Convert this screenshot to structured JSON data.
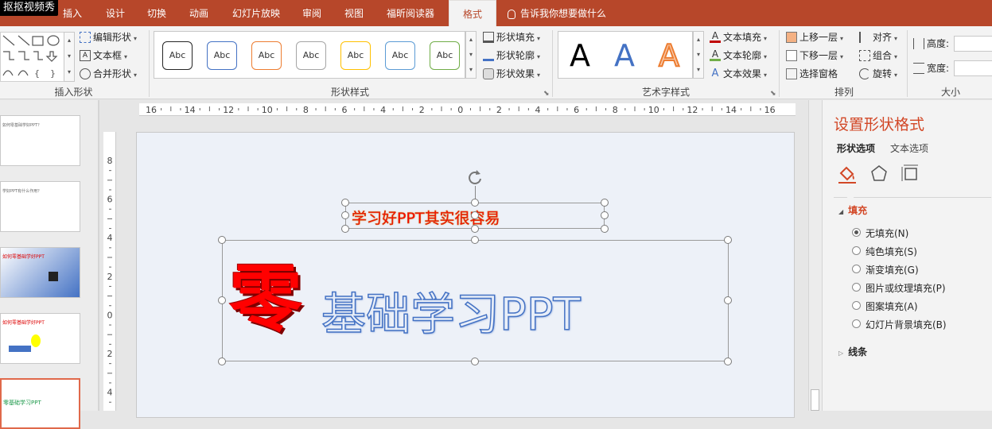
{
  "watermark": "抠抠视频秀",
  "tabs": [
    {
      "label": "插入",
      "active": false
    },
    {
      "label": "设计",
      "active": false
    },
    {
      "label": "切换",
      "active": false
    },
    {
      "label": "动画",
      "active": false
    },
    {
      "label": "幻灯片放映",
      "active": false
    },
    {
      "label": "审阅",
      "active": false
    },
    {
      "label": "视图",
      "active": false
    },
    {
      "label": "福昕阅读器",
      "active": false
    },
    {
      "label": "格式",
      "active": true
    }
  ],
  "tell_me": "告诉我你想要做什么",
  "ribbon": {
    "insert_shapes": {
      "edit_shape": "编辑形状",
      "text_box": "文本框",
      "merge_shapes": "合并形状",
      "label": "插入形状"
    },
    "shape_styles": {
      "preset_text": "Abc",
      "preset_colors": [
        "#262626",
        "#4472c4",
        "#ed7d31",
        "#a5a5a5",
        "#ffc000",
        "#5b9bd5",
        "#70ad47"
      ],
      "fill": "形状填充",
      "outline": "形状轮廓",
      "effects": "形状效果",
      "label": "形状样式"
    },
    "wordart": {
      "letter": "A",
      "text_fill": "文本填充",
      "text_outline": "文本轮廓",
      "text_effects": "文本效果",
      "label": "艺术字样式"
    },
    "arrange": {
      "bring_forward": "上移一层",
      "send_backward": "下移一层",
      "selection_pane": "选择窗格",
      "align": "对齐",
      "group": "组合",
      "rotate": "旋转",
      "label": "排列"
    },
    "size": {
      "height": "高度:",
      "width": "宽度:",
      "label": "大小"
    }
  },
  "thumbnails": [
    {
      "text": "如何零基础学好PPT？",
      "selected": false
    },
    {
      "text": "学好PPT有什么作用？",
      "selected": false
    },
    {
      "text": "如何零基础学好PPT",
      "selected": false
    },
    {
      "text": "如何零基础学好PPT",
      "selected": false
    },
    {
      "text": "零基础学习PPT",
      "selected": true
    }
  ],
  "ruler": {
    "h_ticks": [
      "16",
      "14",
      "12",
      "10",
      "8",
      "6",
      "4",
      "2",
      "0",
      "2",
      "4",
      "6",
      "8",
      "10",
      "12",
      "14",
      "16"
    ],
    "v_ticks": [
      "8",
      "6",
      "4",
      "2",
      "0",
      "2",
      "4"
    ]
  },
  "slide": {
    "subtitle": "学习好PPT其实很容易",
    "big_char": "零",
    "title_rest": "基础学习PPT"
  },
  "panel": {
    "title": "设置形状格式",
    "tab_shape": "形状选项",
    "tab_text": "文本选项",
    "fill_section": "填充",
    "fill_options": [
      {
        "label": "无填充(N)",
        "checked": true
      },
      {
        "label": "纯色填充(S)",
        "checked": false
      },
      {
        "label": "渐变填充(G)",
        "checked": false
      },
      {
        "label": "图片或纹理填充(P)",
        "checked": false
      },
      {
        "label": "图案填充(A)",
        "checked": false
      },
      {
        "label": "幻灯片背景填充(B)",
        "checked": false
      }
    ],
    "line_section": "线条"
  },
  "colors": {
    "accent": "#b7472a",
    "panel_title": "#d24726",
    "wordart_red": "#ff0000",
    "wordart_blue": "#4472c4"
  }
}
